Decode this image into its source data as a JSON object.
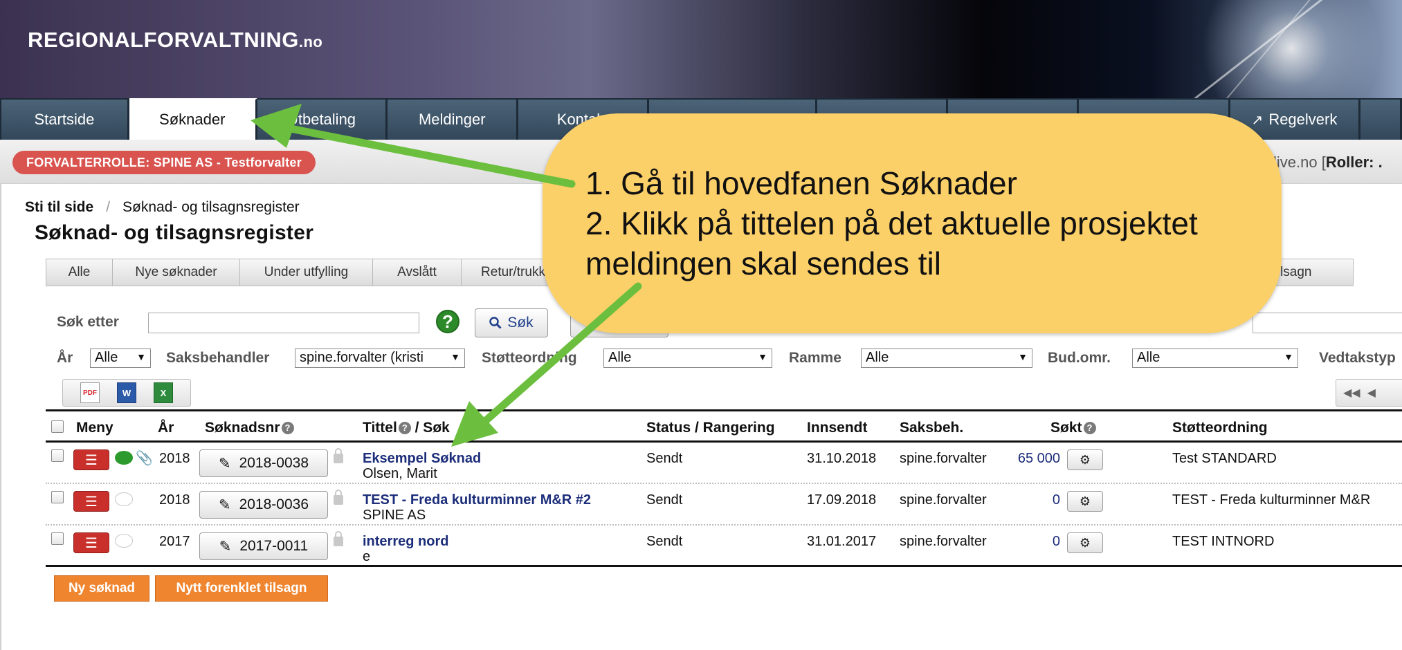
{
  "header": {
    "logo_main": "REGIONALFORVALTNING",
    "logo_suffix": ".no"
  },
  "mainnav": {
    "tabs": [
      {
        "label": "Startside",
        "active": false
      },
      {
        "label": "Søknader",
        "active": true
      },
      {
        "label": "Utbetaling",
        "active": false
      },
      {
        "label": "Meldinger",
        "active": false
      },
      {
        "label": "Kontakt",
        "active": false
      },
      {
        "label": "",
        "active": false
      },
      {
        "label": "",
        "active": false
      },
      {
        "label": "",
        "active": false
      },
      {
        "label": "",
        "active": false
      },
      {
        "label": "Regelverk",
        "active": false
      }
    ]
  },
  "role": {
    "label": "FORVALTERROLLE: SPINE AS - Testforvalter",
    "right_text": "live.no [",
    "right_bold": "Roller: ."
  },
  "breadcrumb": {
    "root": "Sti til side",
    "separator": "/",
    "current": "Søknad- og tilsagnsregister"
  },
  "page_title": "Søknad- og tilsagnsregister",
  "subtabs": [
    "Alle",
    "Nye søknader",
    "Under utfylling",
    "Avslått",
    "Retur/trukk"
  ],
  "subtab_last": "le tilsagn",
  "search": {
    "label": "Søk etter",
    "value": "",
    "button": "Søk",
    "help": "?"
  },
  "filters": {
    "ar_label": "År",
    "ar_value": "Alle",
    "saksbehandler_label": "Saksbehandler",
    "saksbehandler_value": "spine.forvalter (kristi",
    "stotteordning_label": "Støtteordning",
    "stotteordning_value": "Alle",
    "ramme_label": "Ramme",
    "ramme_value": "Alle",
    "budomr_label": "Bud.omr.",
    "budomr_value": "Alle",
    "vedtak_label": "Vedtakstyp"
  },
  "export": {
    "pdf": "PDF",
    "word": "W",
    "excel": "X"
  },
  "table": {
    "headers": {
      "meny": "Meny",
      "ar": "År",
      "soknadsnr": "Søknadsnr",
      "tittel": "Tittel",
      "tittel_sep": "/ Søk",
      "status": "Status / Rangering",
      "innsendt": "Innsendt",
      "saksbeh": "Saksbeh.",
      "sokt": "Søkt",
      "stotteordning": "Støtteordning"
    },
    "rows": [
      {
        "ar": "2018",
        "nr": "2018-0038",
        "tittel": "Eksempel Søknad",
        "sub": "Olsen, Marit",
        "status": "Sendt",
        "innsendt": "31.10.2018",
        "saksbeh": "spine.forvalter",
        "sokt": "65 000",
        "stotte": "Test STANDARD",
        "message": true,
        "attachment": true
      },
      {
        "ar": "2018",
        "nr": "2018-0036",
        "tittel": "TEST - Freda kulturminner M&R #2",
        "sub": "SPINE AS",
        "status": "Sendt",
        "innsendt": "17.09.2018",
        "saksbeh": "spine.forvalter",
        "sokt": "0",
        "stotte": "TEST - Freda kulturminner M&R",
        "message": false,
        "attachment": false
      },
      {
        "ar": "2017",
        "nr": "2017-0011",
        "tittel": "interreg nord",
        "sub": "e",
        "status": "Sendt",
        "innsendt": "31.01.2017",
        "saksbeh": "spine.forvalter",
        "sokt": "0",
        "stotte": "TEST INTNORD",
        "message": false,
        "attachment": false
      }
    ]
  },
  "buttons": {
    "new": "Ny søknad",
    "simplified": "Nytt forenklet tilsagn"
  },
  "annotation": {
    "line1": "1. Gå til hovedfanen Søknader",
    "line2": "2. Klikk på tittelen på det aktuelle prosjektet",
    "line3": "meldingen skal sendes til",
    "arrow_color": "#6cbf3e",
    "callout_color": "#fcd069"
  }
}
